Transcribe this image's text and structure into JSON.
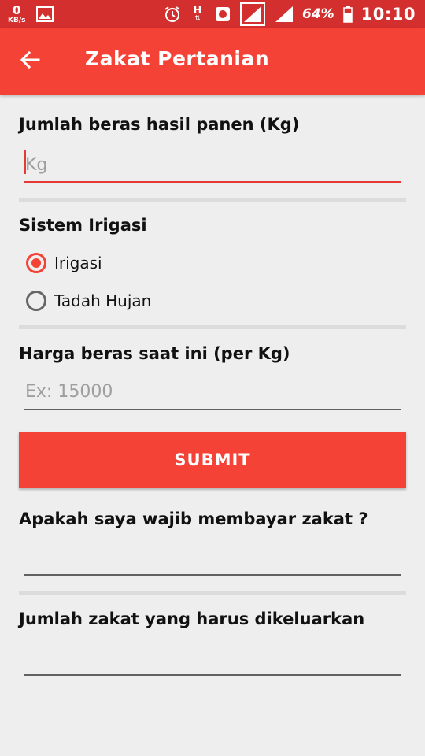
{
  "status_bar": {
    "net_speed": "0",
    "net_unit": "KB/s",
    "signal_type": "H",
    "battery_percent": "64%",
    "time": "10:10",
    "icons": [
      "gallery-icon",
      "alarm-icon",
      "data-arrows-icon",
      "app-notification-icon",
      "signal-icon",
      "signal-icon",
      "battery-icon"
    ]
  },
  "app_bar": {
    "title": "Zakat Pertanian",
    "back_icon": "arrow-left-icon",
    "color": "#f44336"
  },
  "form": {
    "harvest": {
      "label": "Jumlah beras hasil panen (Kg)",
      "placeholder": "Kg",
      "value": ""
    },
    "irrigation": {
      "label": "Sistem Irigasi",
      "options": [
        "Irigasi",
        "Tadah Hujan"
      ],
      "selected": "Irigasi"
    },
    "price": {
      "label": "Harga beras saat ini (per Kg)",
      "placeholder": "Ex: 15000",
      "value": ""
    },
    "submit_label": "SUBMIT"
  },
  "results": {
    "obligation": {
      "label": "Apakah saya wajib membayar zakat ?",
      "value": ""
    },
    "amount": {
      "label": "Jumlah zakat yang harus dikeluarkan",
      "value": ""
    }
  }
}
